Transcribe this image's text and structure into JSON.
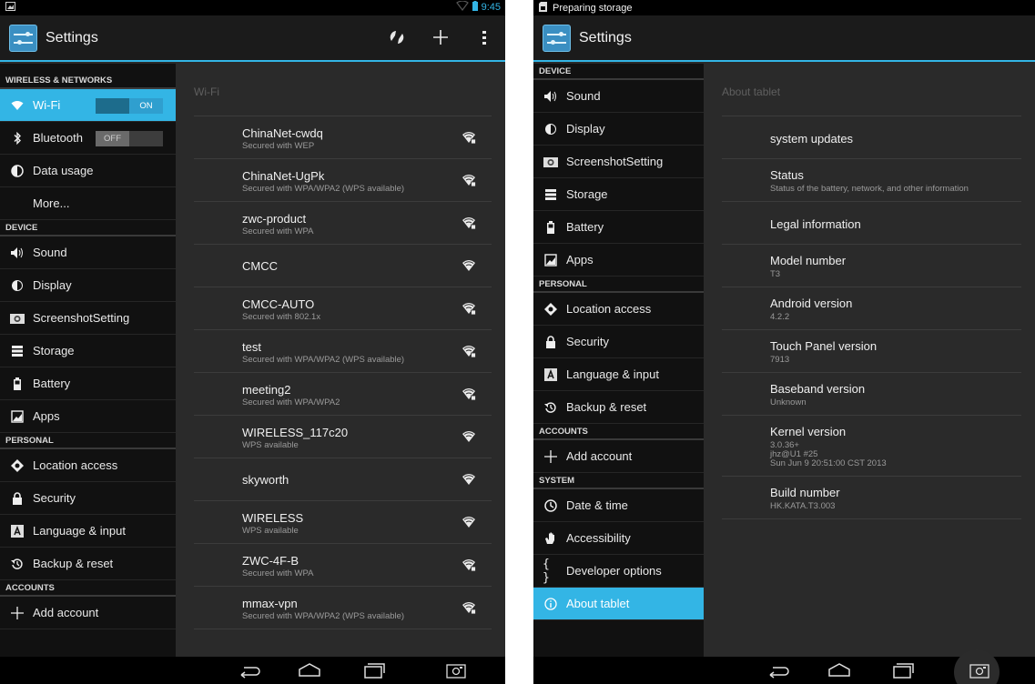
{
  "colors": {
    "accent": "#33b5e5",
    "background": "#2a2a2a",
    "sidebar": "#111111"
  },
  "left": {
    "status": {
      "time": "9:45"
    },
    "app_title": "Settings",
    "sidebar": {
      "wireless_header": "WIRELESS & NETWORKS",
      "wifi": {
        "label": "Wi-Fi",
        "toggle": "ON"
      },
      "bluetooth": {
        "label": "Bluetooth",
        "toggle": "OFF"
      },
      "data_usage": "Data usage",
      "more": "More...",
      "device_header": "DEVICE",
      "device_items": [
        "Sound",
        "Display",
        "ScreenshotSetting",
        "Storage",
        "Battery",
        "Apps"
      ],
      "personal_header": "PERSONAL",
      "personal_items": [
        "Location access",
        "Security",
        "Language & input",
        "Backup & reset"
      ],
      "accounts_header": "ACCOUNTS",
      "add_account": "Add account"
    },
    "content": {
      "title": "Wi-Fi",
      "networks": [
        {
          "ssid": "ChinaNet-cwdq",
          "security": "Secured with WEP",
          "locked": true
        },
        {
          "ssid": "ChinaNet-UgPk",
          "security": "Secured with WPA/WPA2 (WPS available)",
          "locked": true
        },
        {
          "ssid": "zwc-product",
          "security": "Secured with WPA",
          "locked": true
        },
        {
          "ssid": "CMCC",
          "security": "",
          "locked": false
        },
        {
          "ssid": "CMCC-AUTO",
          "security": "Secured with 802.1x",
          "locked": true
        },
        {
          "ssid": "test",
          "security": "Secured with WPA/WPA2 (WPS available)",
          "locked": true
        },
        {
          "ssid": "meeting2",
          "security": "Secured with WPA/WPA2",
          "locked": true
        },
        {
          "ssid": "WIRELESS_117c20",
          "security": "WPS available",
          "locked": false
        },
        {
          "ssid": "skyworth",
          "security": "",
          "locked": false
        },
        {
          "ssid": "WIRELESS",
          "security": "WPS available",
          "locked": false
        },
        {
          "ssid": "ZWC-4F-B",
          "security": "Secured with WPA",
          "locked": true
        },
        {
          "ssid": "mmax-vpn",
          "security": "Secured with WPA/WPA2 (WPS available)",
          "locked": true
        }
      ]
    }
  },
  "right": {
    "status": {
      "notification": "Preparing storage"
    },
    "app_title": "Settings",
    "sidebar": {
      "device_header": "DEVICE",
      "device_items": [
        "Sound",
        "Display",
        "ScreenshotSetting",
        "Storage",
        "Battery",
        "Apps"
      ],
      "personal_header": "PERSONAL",
      "personal_items": [
        "Location access",
        "Security",
        "Language & input",
        "Backup & reset"
      ],
      "accounts_header": "ACCOUNTS",
      "add_account": "Add account",
      "system_header": "SYSTEM",
      "system_items": [
        "Date & time",
        "Accessibility",
        "Developer options",
        "About tablet"
      ]
    },
    "content": {
      "title": "About tablet",
      "rows": [
        {
          "title": "system updates",
          "lines": []
        },
        {
          "title": "Status",
          "lines": [
            "Status of the battery, network, and other information"
          ]
        },
        {
          "title": "Legal information",
          "lines": []
        },
        {
          "title": "Model number",
          "lines": [
            "T3"
          ]
        },
        {
          "title": "Android version",
          "lines": [
            "4.2.2"
          ]
        },
        {
          "title": "Touch Panel version",
          "lines": [
            "7913"
          ]
        },
        {
          "title": "Baseband version",
          "lines": [
            "Unknown"
          ]
        },
        {
          "title": "Kernel version",
          "lines": [
            "3.0.36+",
            "jhz@U1 #25",
            "Sun Jun 9 20:51:00 CST 2013"
          ]
        },
        {
          "title": "Build number",
          "lines": [
            "HK.KATA.T3.003"
          ]
        }
      ]
    }
  }
}
